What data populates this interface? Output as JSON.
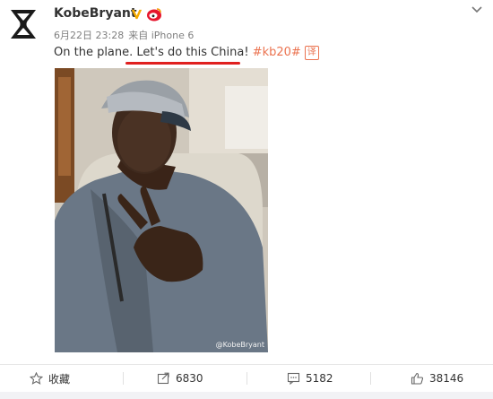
{
  "user": {
    "name": "KobeBryant",
    "verified_icon": "verified-v-icon",
    "member_icon": "weibo-member-icon"
  },
  "post": {
    "date": "6月22日 23:28",
    "source_prefix": "来自",
    "source": "iPhone 6",
    "text_before": "On the plane. ",
    "text_highlight": "Let's do this China!",
    "hashtag": "#kb20#",
    "translate_label": "译",
    "image_watermark": "@KobeBryant"
  },
  "actions": {
    "favorite_label": "收藏",
    "repost_count": "6830",
    "comment_count": "5182",
    "like_count": "38146"
  },
  "colors": {
    "hashtag": "#eb7350",
    "underline": "#e0201f",
    "verified": "#f6ab00"
  }
}
